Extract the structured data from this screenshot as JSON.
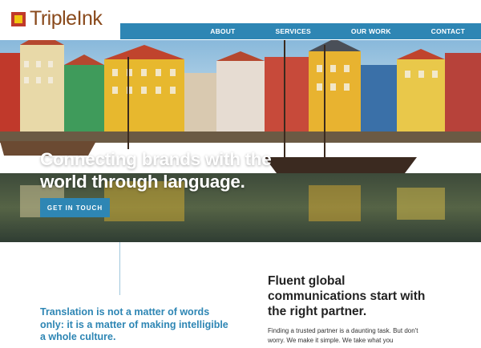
{
  "brand": {
    "name": "TripleInk"
  },
  "nav": {
    "items": [
      {
        "label": "ABOUT"
      },
      {
        "label": "SERVICES"
      },
      {
        "label": "OUR WORK"
      },
      {
        "label": "CONTACT"
      }
    ]
  },
  "hero": {
    "title": "Connecting brands with the world through language.",
    "cta_label": "GET IN TOUCH"
  },
  "intro": {
    "quote": "Translation is not a matter of words only: it is a matter of making intelligible a whole culture.",
    "heading": "Fluent global communications start with the right partner.",
    "body": "Finding a trusted partner is a daunting task. But don't worry. We make it simple. We take what you"
  },
  "colors": {
    "accent": "#2e86b4",
    "logo_brown": "#8a4a1c",
    "logo_red": "#c0392b",
    "logo_yellow": "#f1c40f"
  }
}
